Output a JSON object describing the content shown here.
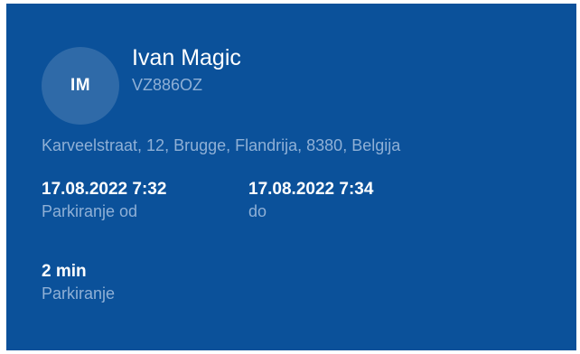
{
  "user": {
    "initials": "IM",
    "name": "Ivan Magic",
    "plate": "VZ886OZ"
  },
  "address": "Karveelstraat, 12, Brugge, Flandrija, 8380, Belgija",
  "parking": {
    "from_value": "17.08.2022 7:32",
    "from_label": "Parkiranje od",
    "to_value": "17.08.2022 7:34",
    "to_label": "do",
    "duration_value": "2 min",
    "duration_label": "Parkiranje"
  },
  "colors": {
    "card_background": "#0b519a",
    "avatar_background": "#2f6aa8",
    "secondary_text": "#8fb0d6",
    "primary_text": "#ffffff"
  }
}
